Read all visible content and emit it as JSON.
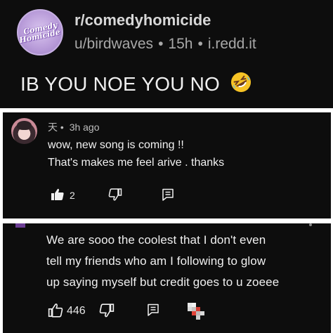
{
  "post": {
    "subreddit": "r/comedyhomicide",
    "subreddit_logo_text": [
      "Comedy",
      "Homicide"
    ],
    "author": "u/birdwaves",
    "age": "15h",
    "domain": "i.redd.it",
    "separator": "•",
    "title": "IB YOU NOE YOU NO",
    "title_emoji": "rolling-on-floor-laughing-icon"
  },
  "comment": {
    "username": "天",
    "separator": "•",
    "time": "3h ago",
    "lines": [
      "wow, new song is coming !!",
      "That's makes me feel arive . thanks"
    ],
    "like_count": "2",
    "icons": [
      "thumbs-up-filled-icon",
      "thumbs-down-icon",
      "reply-icon"
    ]
  },
  "comment2": {
    "lines": [
      "We are sooo the coolest that I don't even",
      "tell my friends who am I following to glow",
      "up saying myself but credit goes to u zoeee"
    ],
    "like_count": "446",
    "icons": [
      "thumbs-up-icon",
      "thumbs-down-icon",
      "reply-icon",
      "pixel-avatar-icon"
    ]
  },
  "colors": {
    "panel_bg": "#0d0d0d",
    "page_bg": "#ffffff",
    "text_primary": "#efefef",
    "text_secondary": "#a8a8a8",
    "accent_purple": "#6d3f95"
  }
}
